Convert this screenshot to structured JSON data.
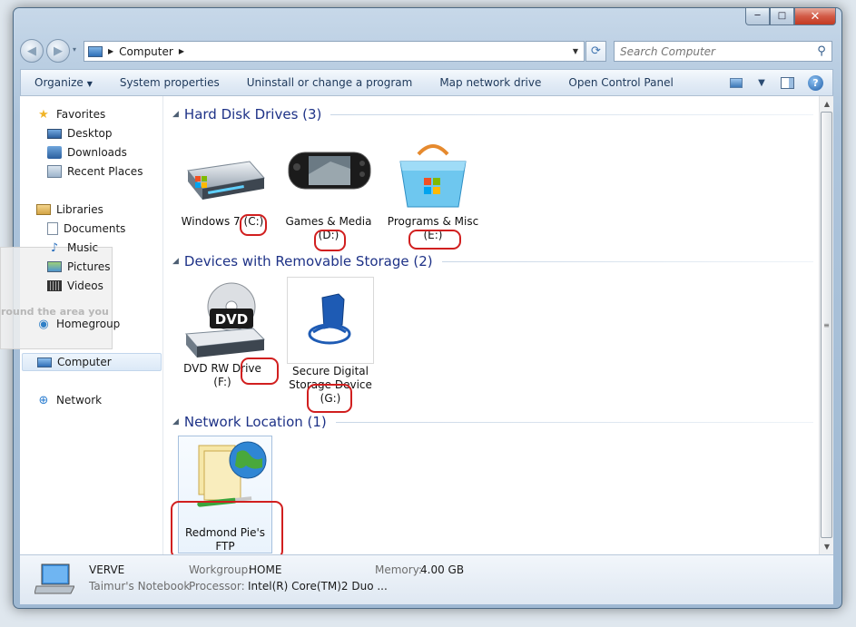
{
  "window": {
    "title": "Computer"
  },
  "caption_buttons": {
    "minimize": "─",
    "maximize": "□",
    "close": "✕"
  },
  "nav": {
    "back_glyph": "◀",
    "forward_glyph": "▶",
    "history_glyph": "▾",
    "breadcrumb": [
      "Computer"
    ],
    "refresh_glyph": "⟳"
  },
  "search": {
    "placeholder": "Search Computer"
  },
  "toolbar": {
    "items": [
      "Organize",
      "System properties",
      "Uninstall or change a program",
      "Map network drive",
      "Open Control Panel"
    ],
    "help_glyph": "?"
  },
  "sidebar": {
    "favorites": {
      "label": "Favorites",
      "items": [
        "Desktop",
        "Downloads",
        "Recent Places"
      ]
    },
    "libraries": {
      "label": "Libraries",
      "items": [
        "Documents",
        "Music",
        "Pictures",
        "Videos"
      ]
    },
    "homegroup": "Homegroup",
    "computer": "Computer",
    "network": "Network",
    "ghost_text": "round the area you"
  },
  "groups": {
    "hard_disk": {
      "title": "Hard Disk Drives (3)",
      "items": [
        {
          "line1": "Windows 7 ",
          "drive": "(C:)"
        },
        {
          "line1": "Games & Media",
          "drive": "(D:)"
        },
        {
          "line1": "Programs & Misc",
          "drive": "(E:)"
        }
      ]
    },
    "removable": {
      "title": "Devices with Removable Storage (2)",
      "items": [
        {
          "line1": "DVD RW Drive ",
          "drive": "(F:)",
          "badge": "DVD"
        },
        {
          "line1": "Secure Digital",
          "line2": "Storage Device",
          "drive": "(G:)"
        }
      ]
    },
    "network": {
      "title": "Network Location (1)",
      "items": [
        {
          "line1": "Redmond Pie's",
          "line2": "FTP"
        }
      ]
    }
  },
  "details": {
    "name": "VERVE",
    "description": "Taimur's Notebook",
    "workgroup_label": "Workgroup:",
    "workgroup_value": "HOME",
    "memory_label": "Memory:",
    "memory_value": "4.00 GB",
    "processor_label": "Processor:",
    "processor_value": "Intel(R) Core(TM)2 Duo ..."
  },
  "colors": {
    "accent_blue": "#1e3287",
    "highlight_red": "#d11f1f",
    "frame": "#aec5dc"
  }
}
